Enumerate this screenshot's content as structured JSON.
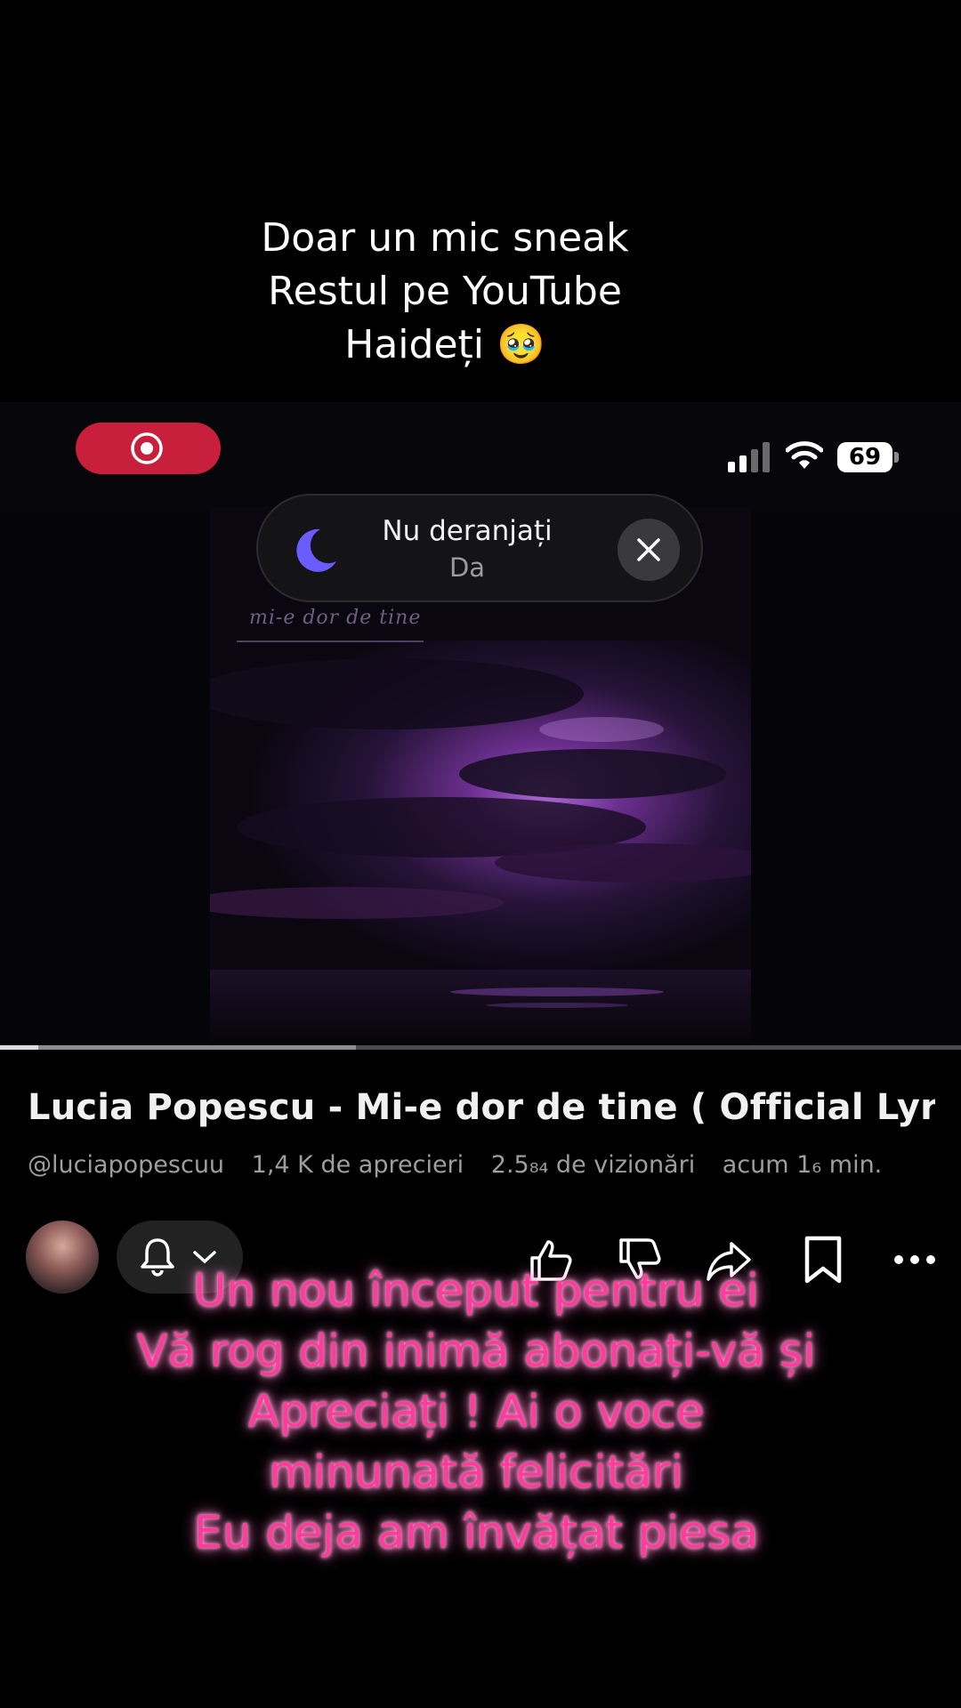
{
  "overlay_top": {
    "lines": [
      "Doar un mic sneak",
      "Restul pe YouTube",
      "Haideți 🥹"
    ]
  },
  "status_bar": {
    "battery": "69",
    "icons": [
      "screen-record-icon",
      "signal-icon",
      "wifi-icon",
      "battery-icon"
    ],
    "record_color": "#c81f3c"
  },
  "dnd_banner": {
    "title": "Nu deranjați",
    "subtitle": "Da",
    "icons": [
      "moon-icon",
      "close-icon"
    ],
    "accent": "#6a5cff"
  },
  "artwork": {
    "handwriting": "mi-e dor de tine"
  },
  "player": {
    "played_fraction": 0.04,
    "buffered_fraction": 0.37
  },
  "video": {
    "title": "Lucia Popescu - Mi-e dor de tine ( Official Lyr...",
    "channel": "@luciapopescuu",
    "likes": "1,4 K de aprecieri",
    "views": "2.5₈₄ de vizionări",
    "time": "acum 1₆ min."
  },
  "actions": {
    "icons": [
      "bell-icon",
      "chevron-down-icon",
      "like-icon",
      "dislike-icon",
      "share-icon",
      "bookmark-icon",
      "more-icon"
    ]
  },
  "overlay_bottom": {
    "lines": [
      "Un nou început pentru ei",
      "Vă rog din inimă abonați-vă și",
      "Apreciați ! Ai o voce",
      "minunată felicitări",
      "Eu deja am învățat piesa"
    ],
    "color": "#ff3c9c"
  }
}
